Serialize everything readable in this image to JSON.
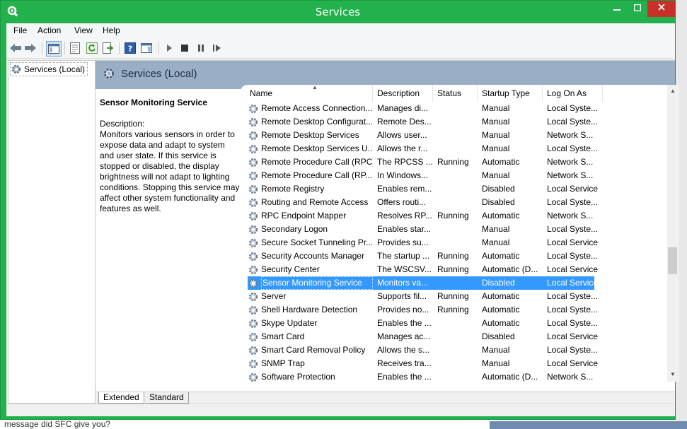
{
  "window": {
    "title": "Services"
  },
  "menu": [
    "File",
    "Action",
    "View",
    "Help"
  ],
  "tree": {
    "root_label": "Services (Local)"
  },
  "header": {
    "title": "Services (Local)"
  },
  "description_pane": {
    "service_name": "Sensor Monitoring Service",
    "label": "Description:",
    "text": "Monitors various sensors in order to expose data and adapt to system and user state.  If this service is stopped or disabled, the display brightness will not adapt to lighting conditions. Stopping this service may affect other system functionality and features as well."
  },
  "columns": [
    "Name",
    "Description",
    "Status",
    "Startup Type",
    "Log On As"
  ],
  "rows": [
    {
      "name": "Remote Access Connection...",
      "desc": "Manages di...",
      "status": "",
      "startup": "Manual",
      "logon": "Local Syste..."
    },
    {
      "name": "Remote Desktop Configurat...",
      "desc": "Remote Des...",
      "status": "",
      "startup": "Manual",
      "logon": "Local Syste..."
    },
    {
      "name": "Remote Desktop Services",
      "desc": "Allows user...",
      "status": "",
      "startup": "Manual",
      "logon": "Network S..."
    },
    {
      "name": "Remote Desktop Services U...",
      "desc": "Allows the r...",
      "status": "",
      "startup": "Manual",
      "logon": "Local Syste..."
    },
    {
      "name": "Remote Procedure Call (RPC)",
      "desc": "The RPCSS ...",
      "status": "Running",
      "startup": "Automatic",
      "logon": "Network S..."
    },
    {
      "name": "Remote Procedure Call (RP...",
      "desc": "In Windows...",
      "status": "",
      "startup": "Manual",
      "logon": "Network S..."
    },
    {
      "name": "Remote Registry",
      "desc": "Enables rem...",
      "status": "",
      "startup": "Disabled",
      "logon": "Local Service"
    },
    {
      "name": "Routing and Remote Access",
      "desc": "Offers routi...",
      "status": "",
      "startup": "Disabled",
      "logon": "Local Syste..."
    },
    {
      "name": "RPC Endpoint Mapper",
      "desc": "Resolves RP...",
      "status": "Running",
      "startup": "Automatic",
      "logon": "Network S..."
    },
    {
      "name": "Secondary Logon",
      "desc": "Enables star...",
      "status": "",
      "startup": "Manual",
      "logon": "Local Syste..."
    },
    {
      "name": "Secure Socket Tunneling Pr...",
      "desc": "Provides su...",
      "status": "",
      "startup": "Manual",
      "logon": "Local Service"
    },
    {
      "name": "Security Accounts Manager",
      "desc": "The startup ...",
      "status": "Running",
      "startup": "Automatic",
      "logon": "Local Syste..."
    },
    {
      "name": "Security Center",
      "desc": "The WSCSV...",
      "status": "Running",
      "startup": "Automatic (D...",
      "logon": "Local Service"
    },
    {
      "name": "Sensor Monitoring Service",
      "desc": "Monitors va...",
      "status": "",
      "startup": "Disabled",
      "logon": "Local Service",
      "selected": true
    },
    {
      "name": "Server",
      "desc": "Supports fil...",
      "status": "Running",
      "startup": "Automatic",
      "logon": "Local Syste..."
    },
    {
      "name": "Shell Hardware Detection",
      "desc": "Provides no...",
      "status": "Running",
      "startup": "Automatic",
      "logon": "Local Syste..."
    },
    {
      "name": "Skype Updater",
      "desc": "Enables the ...",
      "status": "",
      "startup": "Automatic",
      "logon": "Local Syste..."
    },
    {
      "name": "Smart Card",
      "desc": "Manages ac...",
      "status": "",
      "startup": "Disabled",
      "logon": "Local Service"
    },
    {
      "name": "Smart Card Removal Policy",
      "desc": "Allows the s...",
      "status": "",
      "startup": "Manual",
      "logon": "Local Syste..."
    },
    {
      "name": "SNMP Trap",
      "desc": "Receives tra...",
      "status": "",
      "startup": "Manual",
      "logon": "Local Service"
    },
    {
      "name": "Software Protection",
      "desc": "Enables the ...",
      "status": "",
      "startup": "Automatic (D...",
      "logon": "Network S..."
    }
  ],
  "tabs": [
    "Extended",
    "Standard"
  ],
  "background_text": "message did SFC give you?",
  "colors": {
    "window_border": "#22b14c",
    "selection": "#3399ff",
    "header_band": "#9aaec6",
    "close_button": "#c7312a"
  }
}
